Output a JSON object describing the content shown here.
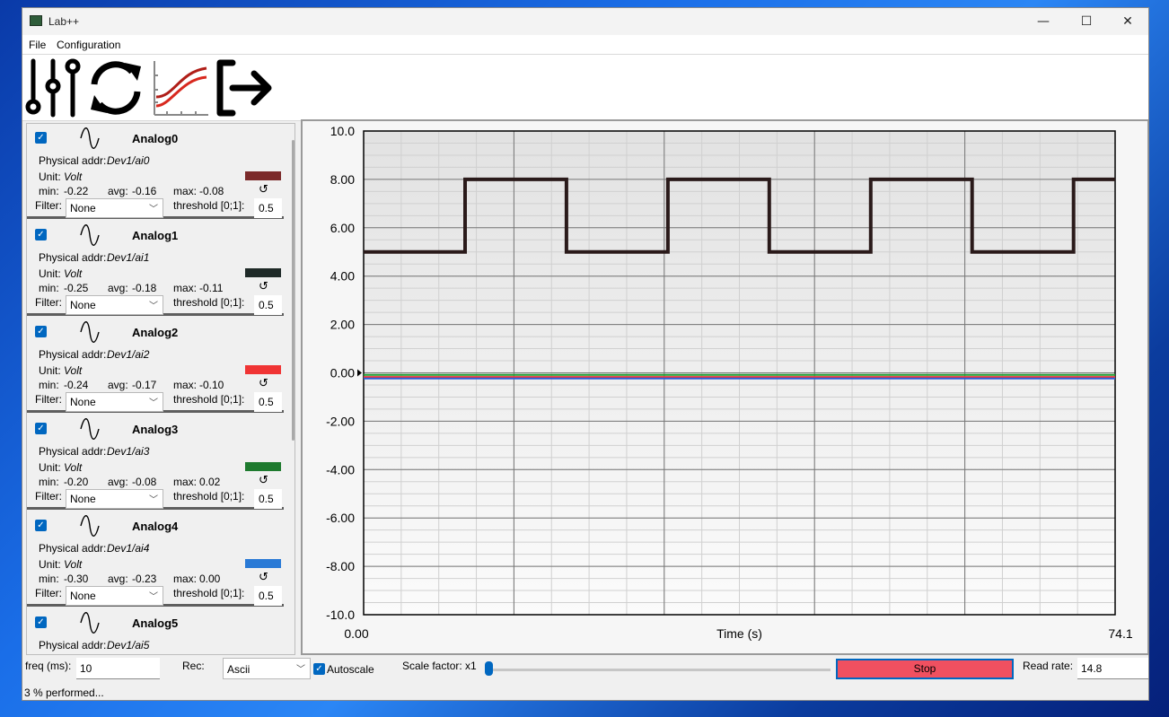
{
  "window": {
    "title": "Lab++",
    "controls": {
      "minimize": "—",
      "maximize": "☐",
      "close": "✕"
    }
  },
  "menu": {
    "file": "File",
    "configuration": "Configuration"
  },
  "toolbar": {
    "icons": [
      "sliders-icon",
      "refresh-icon",
      "chart-icon",
      "exit-icon"
    ]
  },
  "labels": {
    "physical_addr": "Physical addr:",
    "unit": "Unit:",
    "min": "min:",
    "avg": "avg:",
    "max": "max:",
    "filter": "Filter:",
    "threshold": "threshold [0;1]:"
  },
  "channels": [
    {
      "name": "Analog0",
      "addr": "Dev1/ai0",
      "unit": "Volt",
      "min": "-0.22",
      "avg": "-0.16",
      "max": "-0.08",
      "filter": "None",
      "threshold": "0.5",
      "color": "#7b2a2a",
      "checked": true
    },
    {
      "name": "Analog1",
      "addr": "Dev1/ai1",
      "unit": "Volt",
      "min": "-0.25",
      "avg": "-0.18",
      "max": "-0.11",
      "filter": "None",
      "threshold": "0.5",
      "color": "#1f2a28",
      "checked": true
    },
    {
      "name": "Analog2",
      "addr": "Dev1/ai2",
      "unit": "Volt",
      "min": "-0.24",
      "avg": "-0.17",
      "max": "-0.10",
      "filter": "None",
      "threshold": "0.5",
      "color": "#f03434",
      "checked": true
    },
    {
      "name": "Analog3",
      "addr": "Dev1/ai3",
      "unit": "Volt",
      "min": "-0.20",
      "avg": "-0.08",
      "max": "0.02",
      "filter": "None",
      "threshold": "0.5",
      "color": "#1e7a2e",
      "checked": true
    },
    {
      "name": "Analog4",
      "addr": "Dev1/ai4",
      "unit": "Volt",
      "min": "-0.30",
      "avg": "-0.23",
      "max": "0.00",
      "filter": "None",
      "threshold": "0.5",
      "color": "#2a7ad6",
      "checked": true
    },
    {
      "name": "Analog5",
      "addr": "Dev1/ai5",
      "checked": true
    }
  ],
  "bottom": {
    "freq_label": "freq (ms):",
    "freq_value": "10",
    "rec_label": "Rec:",
    "rec_value": "Ascii",
    "autoscale_label": "Autoscale",
    "autoscale_checked": true,
    "scale_factor_label": "Scale factor: x1",
    "scale_factor_level": 0.0,
    "stop_label": "Stop",
    "read_rate_label": "Read rate:",
    "read_rate_value": "14.8"
  },
  "status": {
    "text": "3 % performed..."
  },
  "chart_data": {
    "type": "line",
    "xlabel": "Time (s)",
    "xlim": [
      0.0,
      74.1
    ],
    "x_tick_labels": [
      "0.00",
      "74.1"
    ],
    "ylim": [
      -10.0,
      10.0
    ],
    "y_tick_labels": [
      "10.0",
      "8.00",
      "6.00",
      "4.00",
      "2.00",
      "0.00",
      "-2.00",
      "-4.00",
      "-6.00",
      "-8.00",
      "-10.0"
    ],
    "grid": true,
    "legend": "none",
    "series": [
      {
        "color": "#2a1a1a",
        "x": [
          0.0,
          10.0,
          10.0,
          20.0,
          20.0,
          30.0,
          30.0,
          40.0,
          40.0,
          50.0,
          50.0,
          60.0,
          60.0,
          70.0,
          70.0,
          74.1
        ],
        "values": [
          5.0,
          5.0,
          8.0,
          8.0,
          5.0,
          5.0,
          8.0,
          8.0,
          5.0,
          5.0,
          8.0,
          8.0,
          5.0,
          5.0,
          8.0,
          8.0
        ]
      },
      {
        "color": "#1e9a2e",
        "x": [
          0.0,
          74.1
        ],
        "values": [
          -0.08,
          -0.08
        ]
      },
      {
        "color": "#f03434",
        "x": [
          0.0,
          74.1
        ],
        "values": [
          -0.17,
          -0.17
        ]
      },
      {
        "color": "#2a5ad6",
        "x": [
          0.0,
          74.1
        ],
        "values": [
          -0.23,
          -0.23
        ]
      }
    ]
  }
}
